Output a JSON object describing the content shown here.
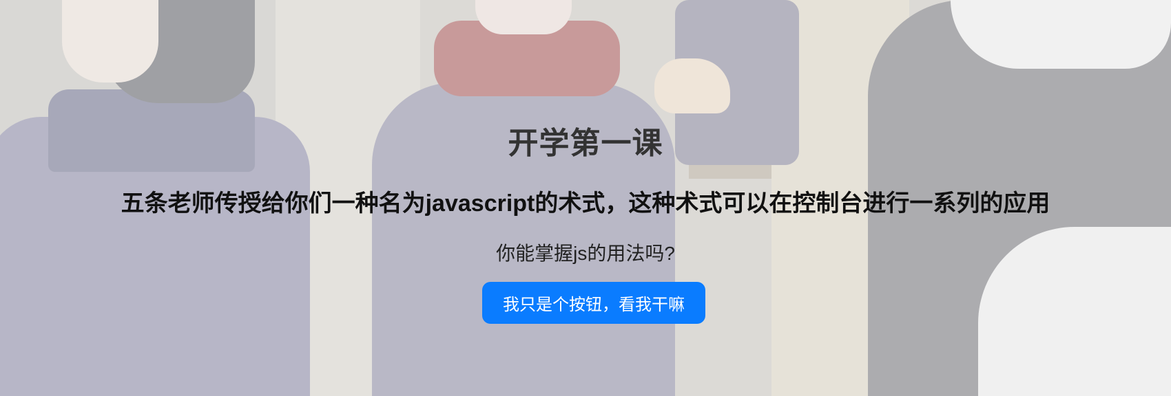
{
  "page": {
    "title": "开学第一课",
    "subtitle": "五条老师传授给你们一种名为javascript的术式，这种术式可以在控制台进行一系列的应用",
    "question": "你能掌握js的用法吗?",
    "button_label": "我只是个按钮，看我干嘛"
  },
  "colors": {
    "button": "#0a7cff",
    "button_text": "#ffffff",
    "title_text": "#333333",
    "subtitle_text": "#111111"
  },
  "background": {
    "description_icon": "faded-anime-background-image"
  }
}
